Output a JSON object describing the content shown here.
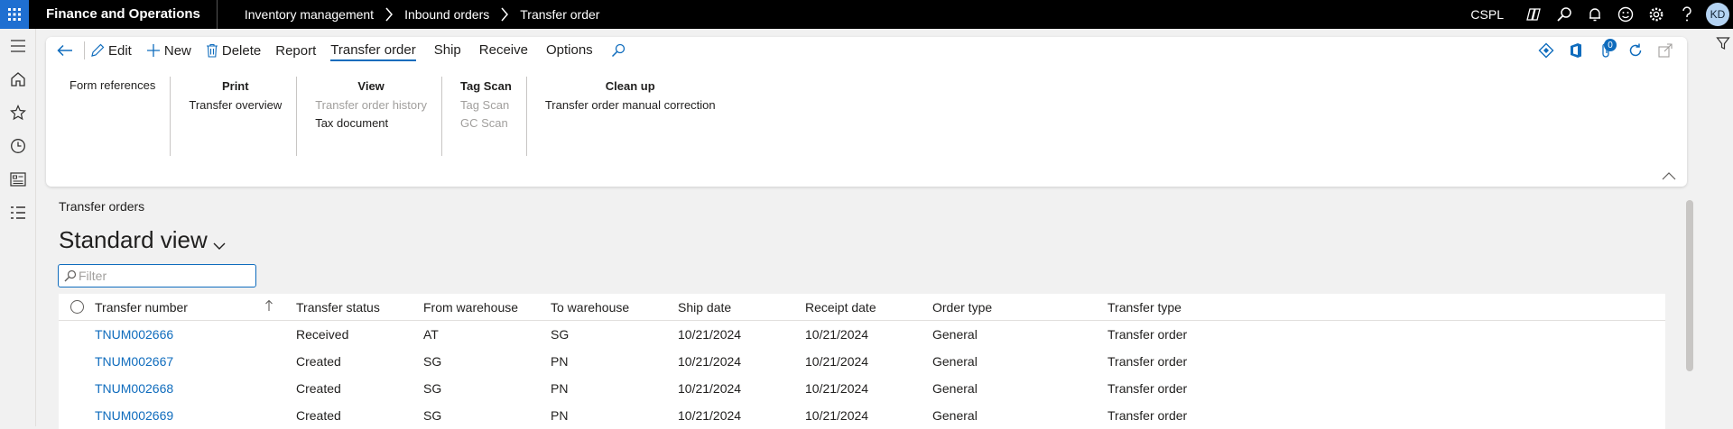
{
  "topbar": {
    "app_title": "Finance and Operations",
    "breadcrumbs": [
      "Inventory management",
      "Inbound orders",
      "Transfer order"
    ],
    "company": "CSPL",
    "user_initials": "KD"
  },
  "action_pane": {
    "buttons": {
      "edit": "Edit",
      "new": "New",
      "delete": "Delete",
      "report": "Report"
    },
    "tabs": [
      "Transfer order",
      "Ship",
      "Receive",
      "Options"
    ],
    "active_tab": "Transfer order",
    "attachment_count": "0",
    "groups": [
      {
        "title": "",
        "items": [
          {
            "label": "Form references",
            "disabled": false
          }
        ]
      },
      {
        "title": "Print",
        "items": [
          {
            "label": "Transfer overview",
            "disabled": false
          }
        ]
      },
      {
        "title": "View",
        "items": [
          {
            "label": "Transfer order history",
            "disabled": true
          },
          {
            "label": "Tax document",
            "disabled": false
          }
        ]
      },
      {
        "title": "Tag Scan",
        "items": [
          {
            "label": "Tag Scan",
            "disabled": true
          },
          {
            "label": "GC Scan",
            "disabled": true
          }
        ]
      },
      {
        "title": "Clean up",
        "items": [
          {
            "label": "Transfer order manual correction",
            "disabled": false
          }
        ]
      }
    ]
  },
  "main": {
    "caption": "Transfer orders",
    "view_name": "Standard view",
    "filter_placeholder": "Filter",
    "grid": {
      "columns": [
        "Transfer number",
        "Transfer status",
        "From warehouse",
        "To warehouse",
        "Ship date",
        "Receipt date",
        "Order type",
        "Transfer type"
      ],
      "rows": [
        [
          "TNUM002666",
          "Received",
          "AT",
          "SG",
          "10/21/2024",
          "10/21/2024",
          "General",
          "Transfer order"
        ],
        [
          "TNUM002667",
          "Created",
          "SG",
          "PN",
          "10/21/2024",
          "10/21/2024",
          "General",
          "Transfer order"
        ],
        [
          "TNUM002668",
          "Created",
          "SG",
          "PN",
          "10/21/2024",
          "10/21/2024",
          "General",
          "Transfer order"
        ],
        [
          "TNUM002669",
          "Created",
          "SG",
          "PN",
          "10/21/2024",
          "10/21/2024",
          "General",
          "Transfer order"
        ]
      ]
    }
  },
  "colors": {
    "accent": "#0f6cbd",
    "topbar": "#000000",
    "waffle": "#1f6fd1"
  }
}
